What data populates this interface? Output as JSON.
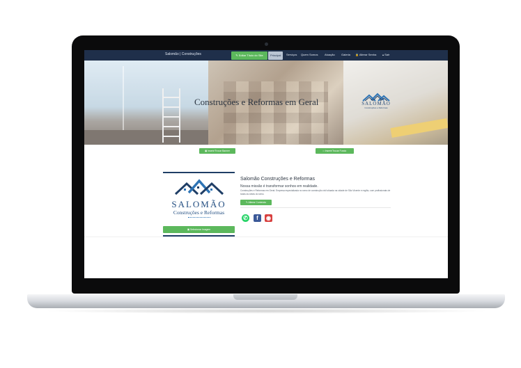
{
  "navbar": {
    "brand": "Salomão | Construções",
    "edit_title_btn": "Editar Título do Site",
    "items": [
      "Principal",
      "Serviços",
      "Quem Somos",
      "Atuação",
      "Galeria",
      "Alterar Senha",
      "Sair"
    ],
    "active_item": "Principal"
  },
  "banner": {
    "title": "Construções e Reformas em Geral",
    "logo_word": "SALOMÃO",
    "logo_sub": "Construções e Reformas"
  },
  "buttons": {
    "banner": "Inserir/Trocar Banner",
    "fundo": "Inserir/Trocar Fundo",
    "contents": "Alterar Conteúdo",
    "image": "Selecionar Imagem"
  },
  "company": {
    "logo_word": "SALOMÃO",
    "logo_sub": "Construções e Reformas",
    "name": "Salomão Construções e Reformas",
    "mission": "Nossa missão é transformar sonhos em realidade.",
    "description": "Construções e Reformas em Geral. Empresa especializada no ramo de construção civil situada na cidade de São Vicente e região, com profissionais de todas as áreas do ramo."
  },
  "social": [
    "whatsapp-icon",
    "facebook-icon",
    "instagram-icon"
  ],
  "colors": {
    "navbar": "#1f2f4a",
    "green": "#5cb85c",
    "brand_blue": "#244f82"
  }
}
